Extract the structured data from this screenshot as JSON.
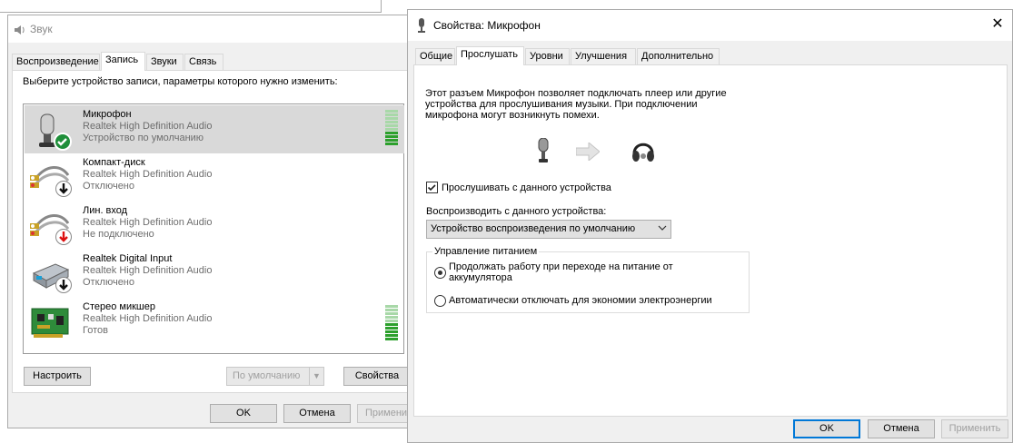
{
  "sound_dialog": {
    "title": "Звук",
    "tabs": [
      "Воспроизведение",
      "Запись",
      "Звуки",
      "Связь"
    ],
    "active_tab": "Запись",
    "instruction": "Выберите устройство записи, параметры которого нужно изменить:",
    "devices": [
      {
        "name": "Микрофон",
        "driver": "Realtek High Definition Audio",
        "status": "Устройство по умолчанию",
        "icon": "microphone-icon",
        "badge": "default-check-icon",
        "selected": true,
        "meter": true
      },
      {
        "name": "Компакт-диск",
        "driver": "Realtek High Definition Audio",
        "status": "Отключено",
        "icon": "rca-cable-icon",
        "badge": "disabled-arrow-icon",
        "selected": false,
        "meter": false
      },
      {
        "name": "Лин. вход",
        "driver": "Realtek High Definition Audio",
        "status": "Не подключено",
        "icon": "rca-cable-icon",
        "badge": "unplugged-arrow-icon",
        "selected": false,
        "meter": false
      },
      {
        "name": "Realtek Digital Input",
        "driver": "Realtek High Definition Audio",
        "status": "Отключено",
        "icon": "digital-input-icon",
        "badge": "disabled-arrow-icon",
        "selected": false,
        "meter": false
      },
      {
        "name": "Стерео микшер",
        "driver": "Realtek High Definition Audio",
        "status": "Готов",
        "icon": "sound-card-icon",
        "badge": "",
        "selected": false,
        "meter": true
      }
    ],
    "buttons": {
      "configure": "Настроить",
      "set_default": "По умолчанию",
      "properties": "Свойства",
      "ok": "OK",
      "cancel": "Отмена",
      "apply": "Примени"
    }
  },
  "props_dialog": {
    "title": "Свойства: Микрофон",
    "tabs": [
      "Общие",
      "Прослушать",
      "Уровни",
      "Улучшения",
      "Дополнительно"
    ],
    "active_tab": "Прослушать",
    "description": [
      "Этот разъем Микрофон позволяет подключать плеер или другие",
      "устройства для прослушивания музыки. При подключении",
      "микрофона могут возникнуть помехи."
    ],
    "listen_checkbox": {
      "label": "Прослушивать с данного устройства",
      "checked": true
    },
    "playback_label": "Воспроизводить с данного устройства:",
    "playback_select": "Устройство воспроизведения по умолчанию",
    "power_group": {
      "legend": "Управление питанием",
      "option1": [
        "Продолжать работу при переходе на питание от",
        "аккумулятора"
      ],
      "option2": "Автоматически отключать для экономии электроэнергии",
      "selected": 1
    },
    "buttons": {
      "ok": "OK",
      "cancel": "Отмена",
      "apply": "Применить"
    }
  },
  "colors": {
    "accent": "#0078d7",
    "meter_green": "#2ca02c",
    "meter_empty": "#a8d8a8",
    "selection": "#d9d9d9",
    "badge_green": "#1f8f3a"
  }
}
